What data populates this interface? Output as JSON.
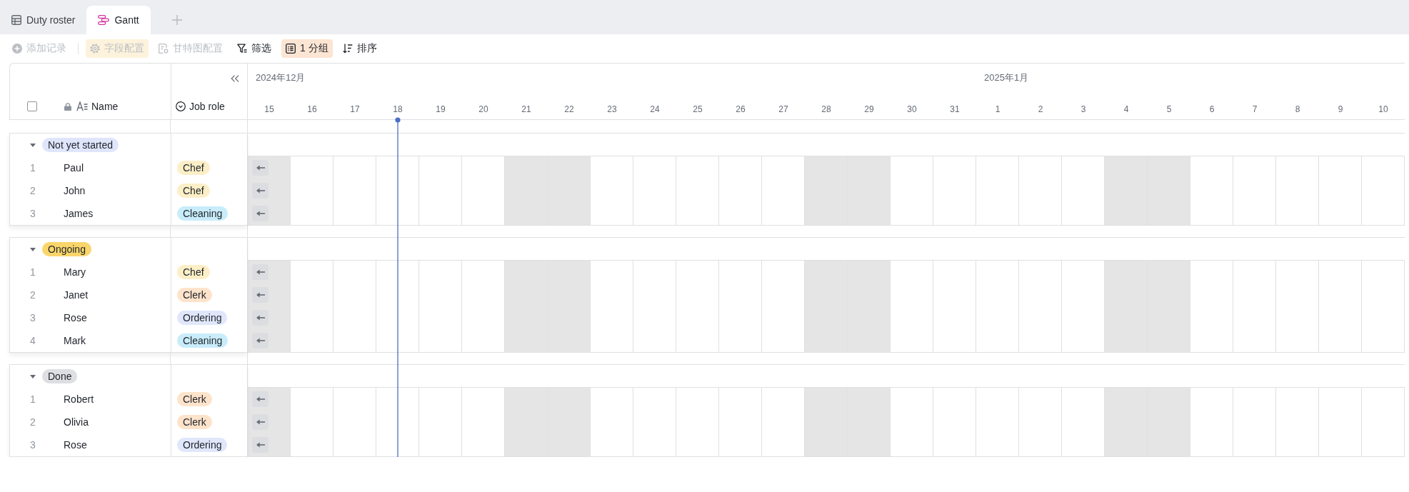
{
  "tabs": [
    {
      "label": "Duty roster",
      "kind": "table",
      "selected": false
    },
    {
      "label": "Gantt",
      "kind": "gantt",
      "selected": true
    }
  ],
  "toolbar": [
    {
      "label": "添加记录",
      "kind": "add",
      "disabled": true,
      "active": false,
      "divider_after": true
    },
    {
      "label": "字段配置",
      "kind": "fields",
      "disabled": true,
      "active": true,
      "color": "#fdf3dc",
      "divider_after": false
    },
    {
      "label": "甘特图配置",
      "kind": "gantt",
      "disabled": true,
      "active": false,
      "divider_after": false
    },
    {
      "label": "筛选",
      "kind": "filter",
      "disabled": false,
      "active": false,
      "divider_after": false
    },
    {
      "label": "1 分组",
      "kind": "group",
      "disabled": false,
      "active": true,
      "color": "#fde5d3",
      "divider_after": false
    },
    {
      "label": "排序",
      "kind": "sort",
      "disabled": false,
      "active": false,
      "divider_after": false
    }
  ],
  "grid": {
    "select_all": {
      "checked": false
    },
    "columns": [
      {
        "label": "Name",
        "kind": "text",
        "locked": true
      },
      {
        "label": "Job role",
        "kind": "select",
        "locked": false
      }
    ]
  },
  "timeline": {
    "months": [
      {
        "label": "2024年12月",
        "days": [
          {
            "label": "15",
            "weekend": true,
            "today": false
          },
          {
            "label": "16",
            "weekend": false,
            "today": false
          },
          {
            "label": "17",
            "weekend": false,
            "today": false
          },
          {
            "label": "18",
            "weekend": false,
            "today": true
          },
          {
            "label": "19",
            "weekend": false,
            "today": false
          },
          {
            "label": "20",
            "weekend": false,
            "today": false
          },
          {
            "label": "21",
            "weekend": true,
            "today": false
          },
          {
            "label": "22",
            "weekend": true,
            "today": false
          },
          {
            "label": "23",
            "weekend": false,
            "today": false
          },
          {
            "label": "24",
            "weekend": false,
            "today": false
          },
          {
            "label": "25",
            "weekend": false,
            "today": false
          },
          {
            "label": "26",
            "weekend": false,
            "today": false
          },
          {
            "label": "27",
            "weekend": false,
            "today": false
          },
          {
            "label": "28",
            "weekend": true,
            "today": false
          },
          {
            "label": "29",
            "weekend": true,
            "today": false
          },
          {
            "label": "30",
            "weekend": false,
            "today": false
          },
          {
            "label": "31",
            "weekend": false,
            "today": false
          }
        ]
      },
      {
        "label": "2025年1月",
        "days": [
          {
            "label": "1",
            "weekend": false,
            "today": false
          },
          {
            "label": "2",
            "weekend": false,
            "today": false
          },
          {
            "label": "3",
            "weekend": false,
            "today": false
          },
          {
            "label": "4",
            "weekend": true,
            "today": false
          },
          {
            "label": "5",
            "weekend": true,
            "today": false
          },
          {
            "label": "6",
            "weekend": false,
            "today": false
          },
          {
            "label": "7",
            "weekend": false,
            "today": false
          },
          {
            "label": "8",
            "weekend": false,
            "today": false
          },
          {
            "label": "9",
            "weekend": false,
            "today": false
          },
          {
            "label": "10",
            "weekend": false,
            "today": false
          }
        ]
      }
    ]
  },
  "groups": [
    {
      "label": "Not yet started",
      "color": "#dfe5fb",
      "expanded": true,
      "records": [
        {
          "number": "1",
          "name": "Paul",
          "job_role": {
            "label": "Chef",
            "color": "#fcefc7"
          },
          "bar_off_left": true
        },
        {
          "number": "2",
          "name": "John",
          "job_role": {
            "label": "Chef",
            "color": "#fcefc7"
          },
          "bar_off_left": true
        },
        {
          "number": "3",
          "name": "James",
          "job_role": {
            "label": "Cleaning",
            "color": "#c8ecfa"
          },
          "bar_off_left": true
        }
      ]
    },
    {
      "label": "Ongoing",
      "color": "#f9d66b",
      "expanded": true,
      "records": [
        {
          "number": "1",
          "name": "Mary",
          "job_role": {
            "label": "Chef",
            "color": "#fcefc7"
          },
          "bar_off_left": true
        },
        {
          "number": "2",
          "name": "Janet",
          "job_role": {
            "label": "Clerk",
            "color": "#fee3cb"
          },
          "bar_off_left": true
        },
        {
          "number": "3",
          "name": "Rose",
          "job_role": {
            "label": "Ordering",
            "color": "#e0e7fb"
          },
          "bar_off_left": true
        },
        {
          "number": "4",
          "name": "Mark",
          "job_role": {
            "label": "Cleaning",
            "color": "#c8ecfa"
          },
          "bar_off_left": true
        }
      ]
    },
    {
      "label": "Done",
      "color": "#dedfe3",
      "expanded": true,
      "records": [
        {
          "number": "1",
          "name": "Robert",
          "job_role": {
            "label": "Clerk",
            "color": "#fee3cb"
          },
          "bar_off_left": true
        },
        {
          "number": "2",
          "name": "Olivia",
          "job_role": {
            "label": "Clerk",
            "color": "#fee3cb"
          },
          "bar_off_left": true
        },
        {
          "number": "3",
          "name": "Rose",
          "job_role": {
            "label": "Ordering",
            "color": "#e0e7fb"
          },
          "bar_off_left": true
        }
      ]
    }
  ]
}
